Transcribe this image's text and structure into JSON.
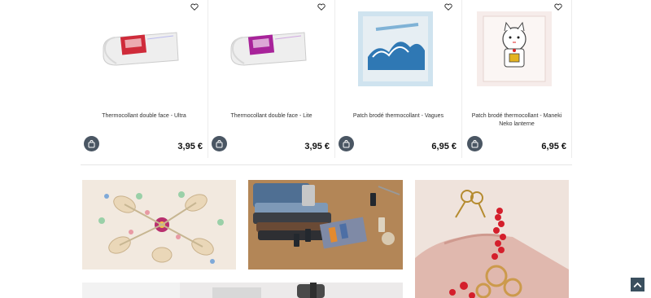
{
  "products": [
    {
      "name": "Thermocollant double face - Ultra",
      "price": "3,95 €",
      "wishlist_icon": "heart-outline-icon",
      "cart_icon": "shopping-bag-icon"
    },
    {
      "name": "Thermocollant double face - Lite",
      "price": "3,95 €",
      "wishlist_icon": "heart-outline-icon",
      "cart_icon": "shopping-bag-icon"
    },
    {
      "name": "Patch brodé thermocollant - Vagues",
      "price": "6,95 €",
      "wishlist_icon": "heart-outline-icon",
      "cart_icon": "shopping-bag-icon"
    },
    {
      "name": "Patch brodé thermocollant - Maneki Neko lanterne",
      "price": "6,95 €",
      "wishlist_icon": "heart-outline-icon",
      "cart_icon": "shopping-bag-icon"
    }
  ],
  "colors": {
    "cart_button": "#4a5663",
    "scroll_top_button": "#3a4f5e",
    "divider": "#e6e6e6"
  },
  "scroll_top": {
    "icon": "chevron-up-icon"
  }
}
